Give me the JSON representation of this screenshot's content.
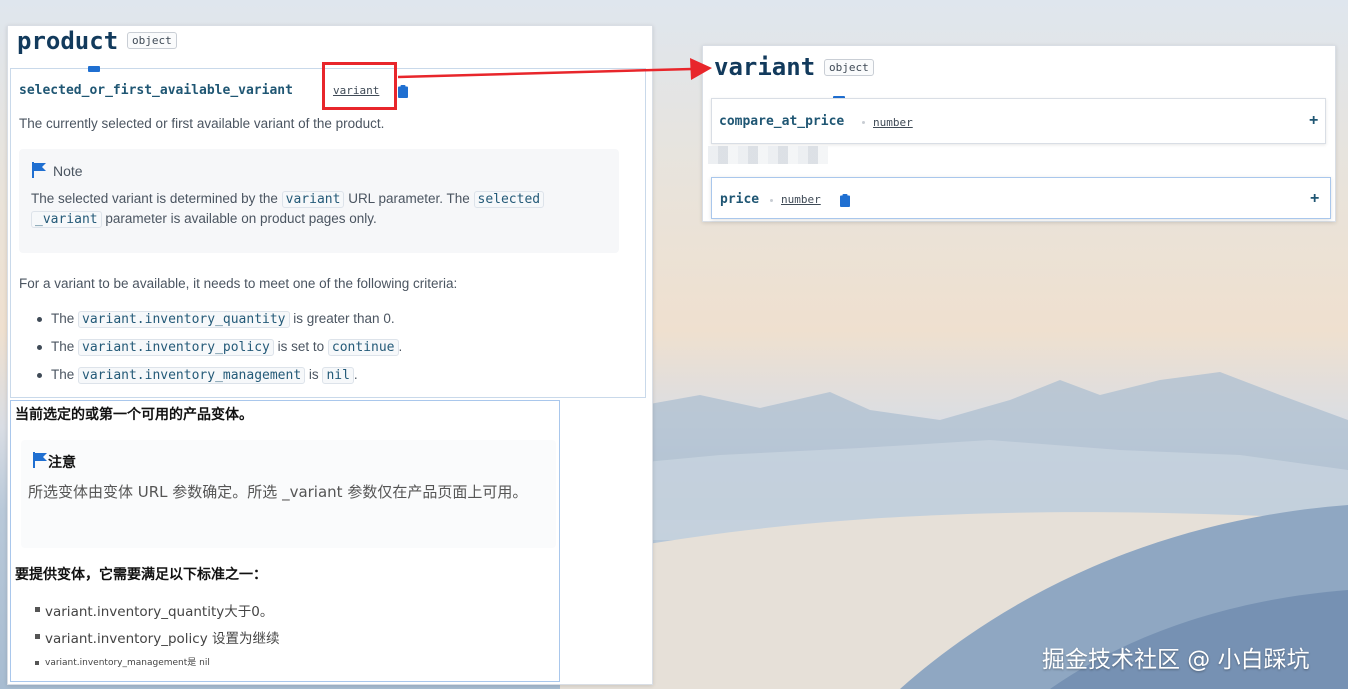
{
  "product_panel": {
    "title": "product",
    "type_badge": "object",
    "property": {
      "name": "selected_or_first_available_variant",
      "type": "variant"
    },
    "description": "The currently selected or first available variant of the product.",
    "note": {
      "title": "Note",
      "line1_a": "The selected variant is determined by the ",
      "line1_code": "variant",
      "line1_b": " URL parameter. The ",
      "line1_code2": "selected",
      "line2_code": "_variant",
      "line2_b": " parameter is available on product pages only."
    },
    "criteria_intro": "For a variant to be available, it needs to meet one of the following criteria:",
    "criteria": [
      {
        "pre": "The ",
        "code": "variant.inventory_quantity",
        "post": " is greater than 0.",
        "code2": "",
        "post2": ""
      },
      {
        "pre": "The ",
        "code": "variant.inventory_policy",
        "post": " is set to ",
        "code2": "continue",
        "post2": "."
      },
      {
        "pre": "The ",
        "code": "variant.inventory_management",
        "post": " is ",
        "code2": "nil",
        "post2": "."
      }
    ]
  },
  "translation_panel": {
    "description": "当前选定的或第一个可用的产品变体。",
    "note_title": "注意",
    "note_text": "所选变体由变体 URL 参数确定。所选 _variant 参数仅在产品页面上可用。",
    "criteria_intro": "要提供变体，它需要满足以下标准之一：",
    "items": [
      "variant.inventory_quantity大于0。",
      "variant.inventory_policy 设置为继续",
      "variant.inventory_management是 nil"
    ]
  },
  "variant_panel": {
    "title": "variant",
    "type_badge": "object",
    "properties": [
      {
        "name": "compare_at_price",
        "type": "number"
      },
      {
        "name": "price",
        "type": "number"
      }
    ]
  },
  "watermark": "掘金技术社区 @ 小白踩坑",
  "colors": {
    "highlight_red": "#e8262b",
    "accent_blue": "#1f6fd1"
  }
}
